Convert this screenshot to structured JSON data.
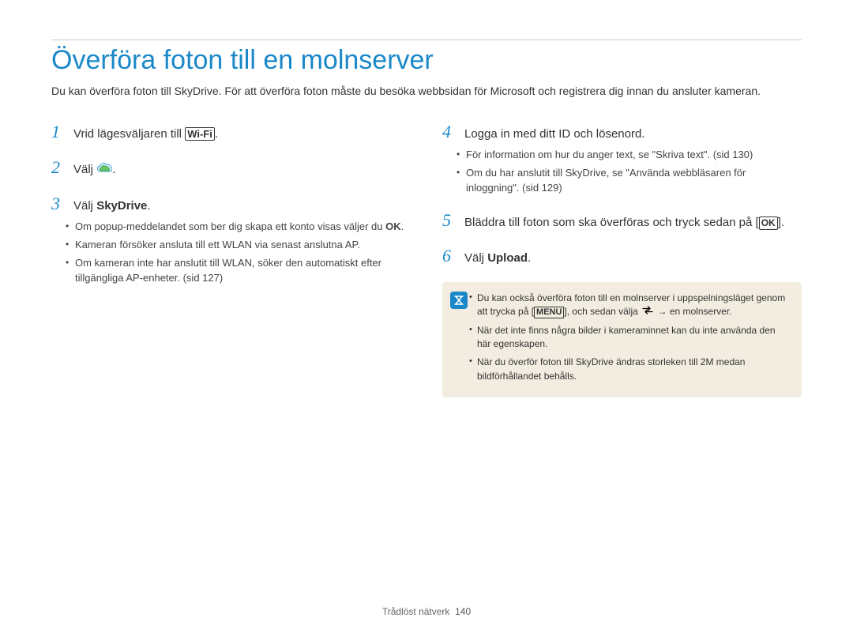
{
  "title": "Överföra foton till en molnserver",
  "intro": "Du kan överföra foton till SkyDrive. För att överföra foton måste du besöka webbsidan för Microsoft och registrera dig innan du ansluter kameran.",
  "left": {
    "step1": {
      "num": "1",
      "pre": "Vrid lägesväljaren till ",
      "wifi": "Wi-Fi",
      "post": "."
    },
    "step2": {
      "num": "2",
      "pre": "Välj ",
      "post": "."
    },
    "step3": {
      "num": "3",
      "pre": "Välj ",
      "bold": "SkyDrive",
      "post": ".",
      "bullets": {
        "b1a": "Om popup-meddelandet som ber dig skapa ett konto visas väljer du ",
        "b1b": "OK",
        "b1c": ".",
        "b2": "Kameran försöker ansluta till ett WLAN via senast anslutna AP.",
        "b3": "Om kameran inte har anslutit till WLAN, söker den automatiskt efter tillgängliga AP-enheter. (sid 127)"
      }
    }
  },
  "right": {
    "step4": {
      "num": "4",
      "text": "Logga in med ditt ID och lösenord.",
      "bullets": {
        "b1": "För information om hur du anger text, se \"Skriva text\". (sid 130)",
        "b2": "Om du har anslutit till SkyDrive, se \"Använda webbläsaren för inloggning\". (sid 129)"
      }
    },
    "step5": {
      "num": "5",
      "pre": "Bläddra till foton som ska överföras och tryck sedan på [",
      "ok": "OK",
      "post": "]."
    },
    "step6": {
      "num": "6",
      "pre": "Välj ",
      "bold": "Upload",
      "post": "."
    },
    "note": {
      "n1a": "Du kan också överföra foton till en molnserver i uppspelningsläget genom att trycka på [",
      "menu": "MENU",
      "n1b": "], och sedan välja ",
      "n1c": " → en molnserver.",
      "n2": "När det inte finns några bilder i kameraminnet kan du inte använda den här egenskapen.",
      "n3": "När du överför foton till SkyDrive ändras storleken till 2M medan bildförhållandet behålls."
    }
  },
  "footer": {
    "section": "Trådlöst nätverk",
    "page": "140"
  }
}
